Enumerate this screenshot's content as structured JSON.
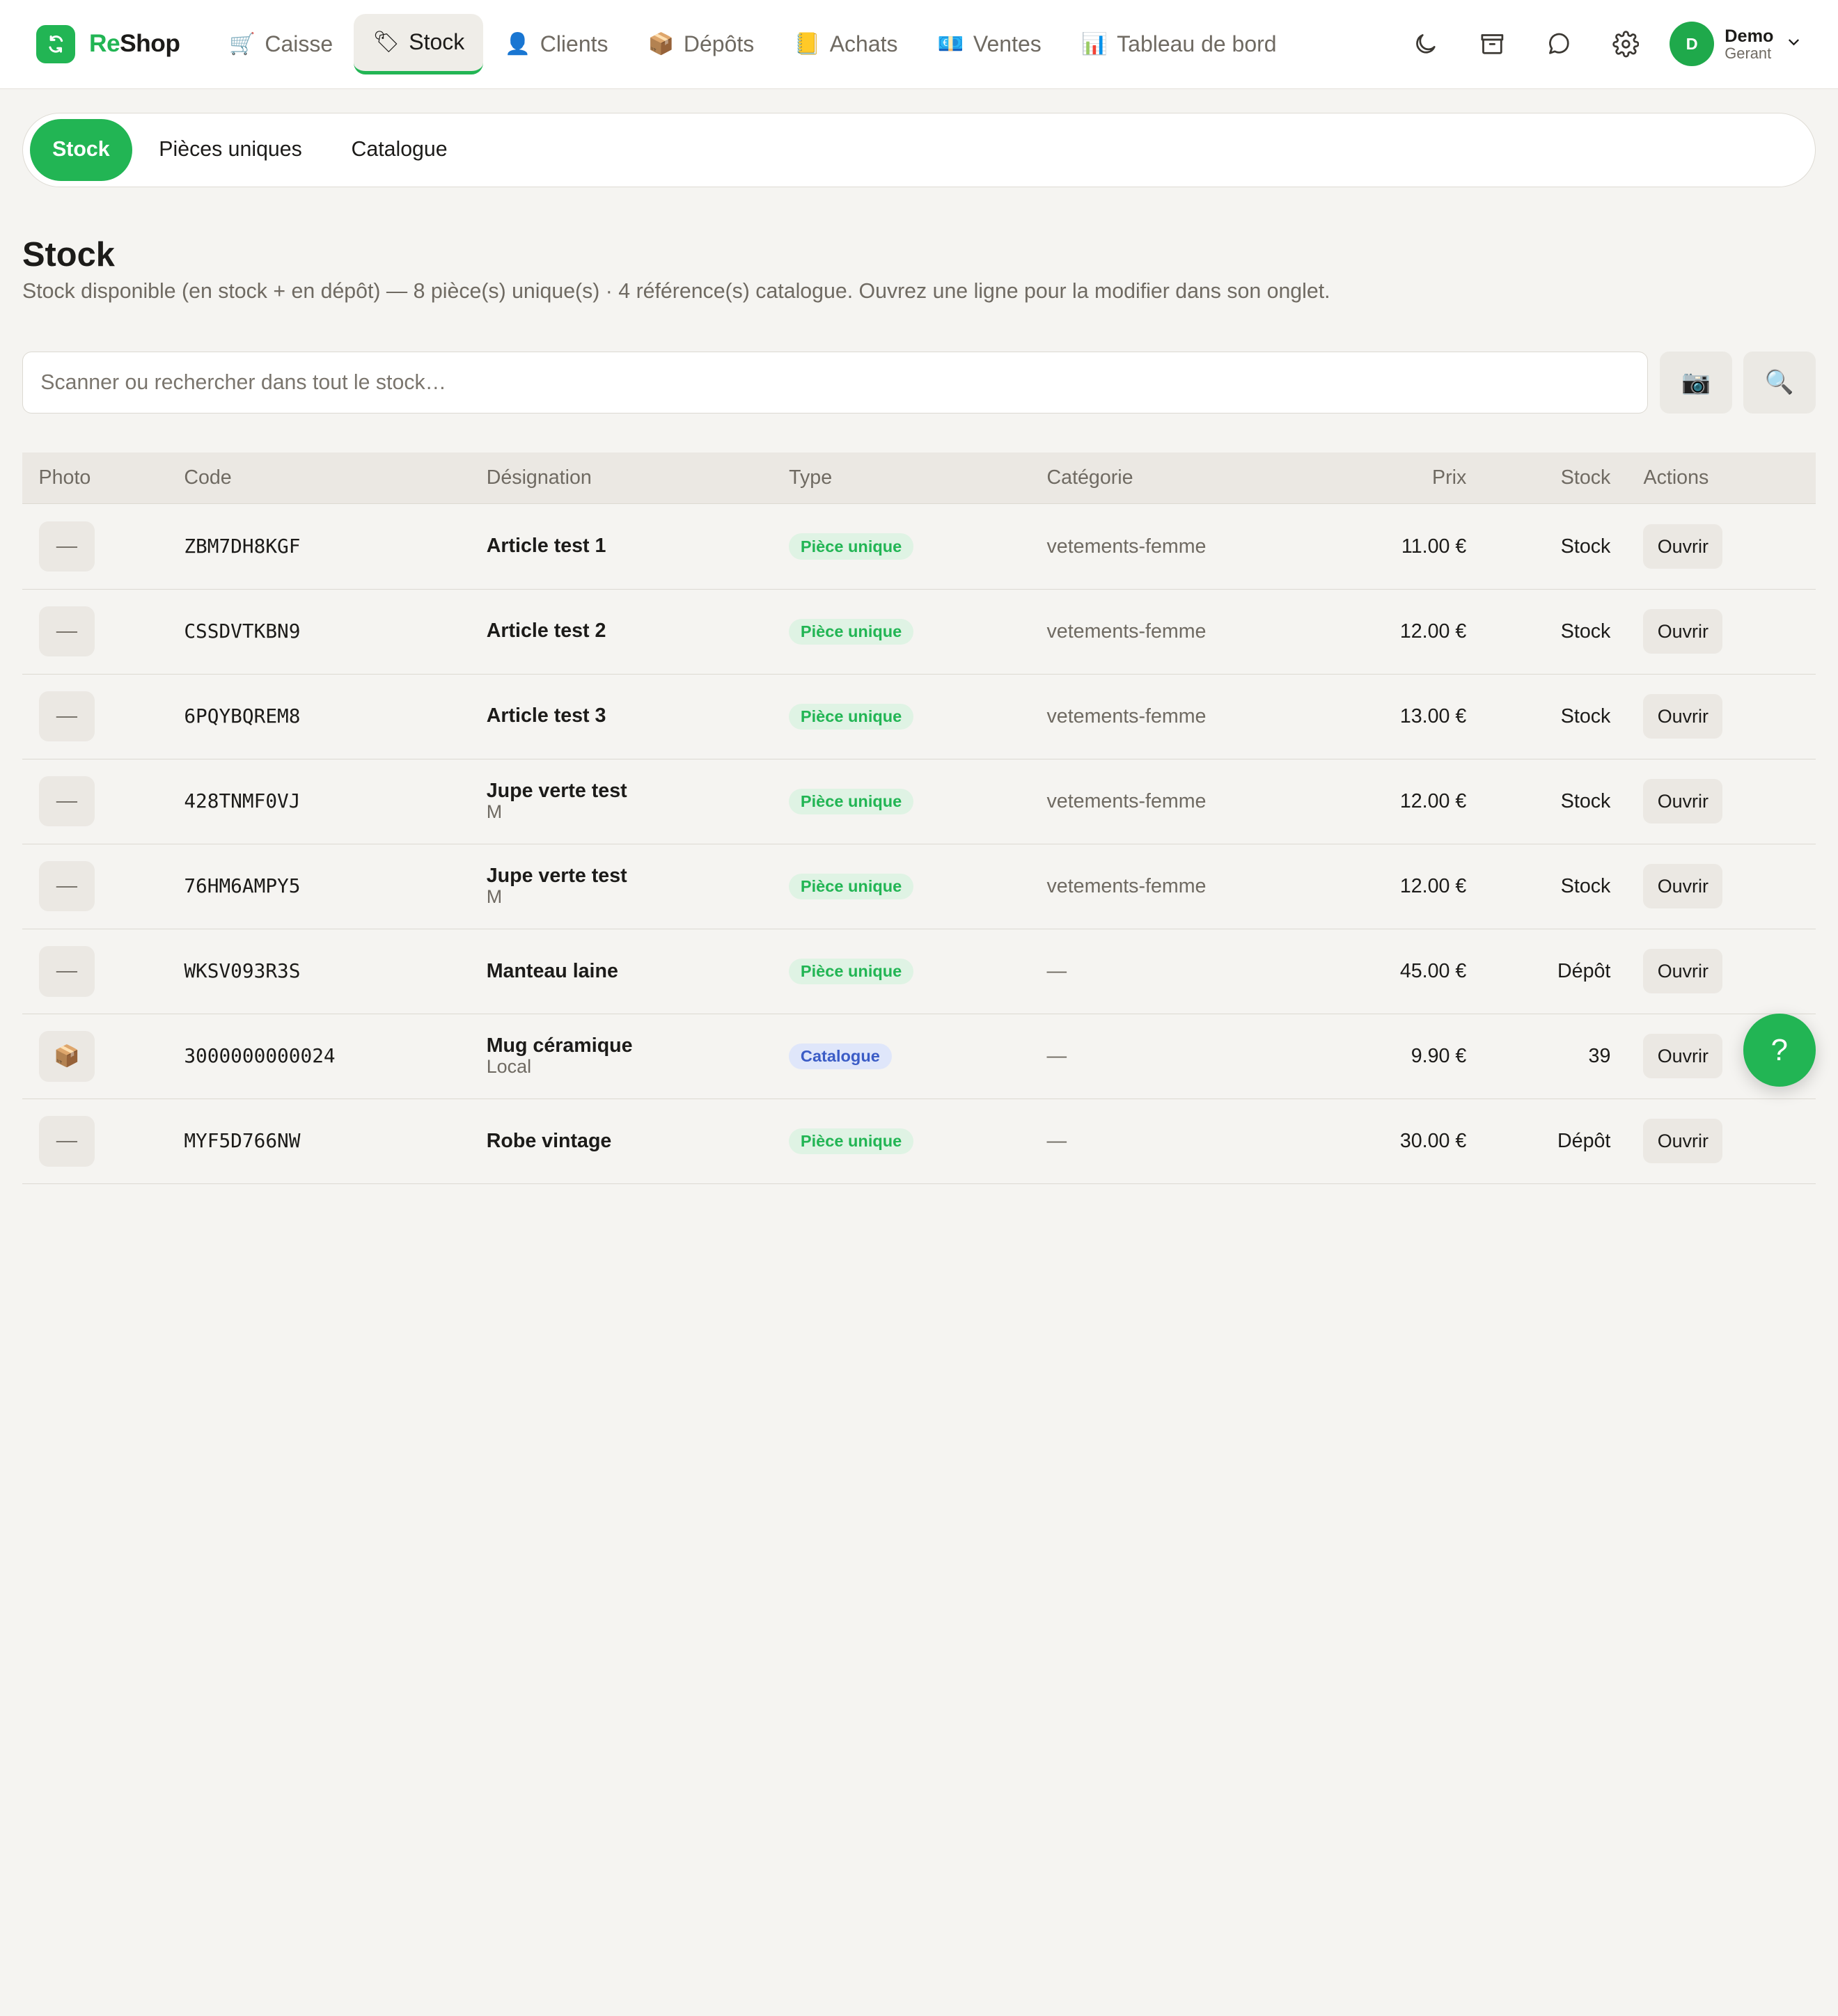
{
  "app": {
    "brand_prefix": "Re",
    "brand_suffix": "Shop",
    "logo_icon": "reshop-logo"
  },
  "nav": [
    {
      "icon": "🛒",
      "label": "Caisse"
    },
    {
      "icon": "🏷",
      "label": "Stock"
    },
    {
      "icon": "👤",
      "label": "Clients"
    },
    {
      "icon": "📦",
      "label": "Dépôts"
    },
    {
      "icon": "📒",
      "label": "Achats"
    },
    {
      "icon": "💶",
      "label": "Ventes"
    },
    {
      "icon": "📊",
      "label": "Tableau de bord"
    }
  ],
  "user": {
    "initial": "D",
    "name": "Demo",
    "role": "Gerant"
  },
  "subtabs": [
    "Stock",
    "Pièces uniques",
    "Catalogue"
  ],
  "page": {
    "title": "Stock",
    "subtitle": "Stock disponible (en stock + en dépôt) — 8 pièce(s) unique(s) · 4 référence(s) catalogue. Ouvrez une ligne pour la modifier dans son onglet."
  },
  "search": {
    "placeholder": "Scanner ou rechercher dans tout le stock…",
    "value": "",
    "camera_icon": "📷",
    "search_icon": "🔍"
  },
  "table": {
    "headers": {
      "photo": "Photo",
      "code": "Code",
      "designation": "Désignation",
      "type": "Type",
      "category": "Catégorie",
      "price": "Prix",
      "stock": "Stock",
      "actions": "Actions"
    },
    "rows": [
      {
        "photo": "—",
        "code": "ZBM7DH8KGF",
        "name": "Article test 1",
        "sub": "",
        "type": "Pièce unique",
        "type_kind": "unique",
        "category": "vetements-femme",
        "price": "11.00 €",
        "stock": "Stock",
        "action": "Ouvrir"
      },
      {
        "photo": "—",
        "code": "CSSDVTKBN9",
        "name": "Article test 2",
        "sub": "",
        "type": "Pièce unique",
        "type_kind": "unique",
        "category": "vetements-femme",
        "price": "12.00 €",
        "stock": "Stock",
        "action": "Ouvrir"
      },
      {
        "photo": "—",
        "code": "6PQYBQREM8",
        "name": "Article test 3",
        "sub": "",
        "type": "Pièce unique",
        "type_kind": "unique",
        "category": "vetements-femme",
        "price": "13.00 €",
        "stock": "Stock",
        "action": "Ouvrir"
      },
      {
        "photo": "—",
        "code": "428TNMF0VJ",
        "name": "Jupe verte test",
        "sub": "M",
        "type": "Pièce unique",
        "type_kind": "unique",
        "category": "vetements-femme",
        "price": "12.00 €",
        "stock": "Stock",
        "action": "Ouvrir"
      },
      {
        "photo": "—",
        "code": "76HM6AMPY5",
        "name": "Jupe verte test",
        "sub": "M",
        "type": "Pièce unique",
        "type_kind": "unique",
        "category": "vetements-femme",
        "price": "12.00 €",
        "stock": "Stock",
        "action": "Ouvrir"
      },
      {
        "photo": "—",
        "code": "WKSV093R3S",
        "name": "Manteau laine",
        "sub": "",
        "type": "Pièce unique",
        "type_kind": "unique",
        "category": "—",
        "price": "45.00 €",
        "stock": "Dépôt",
        "action": "Ouvrir"
      },
      {
        "photo": "📦",
        "code": "3000000000024",
        "name": "Mug céramique",
        "sub": "Local",
        "type": "Catalogue",
        "type_kind": "catalogue",
        "category": "—",
        "price": "9.90 €",
        "stock": "39",
        "action": "Ouvrir"
      },
      {
        "photo": "—",
        "code": "MYF5D766NW",
        "name": "Robe vintage",
        "sub": "",
        "type": "Pièce unique",
        "type_kind": "unique",
        "category": "—",
        "price": "30.00 €",
        "stock": "Dépôt",
        "action": "Ouvrir"
      }
    ]
  },
  "help": {
    "label": "?"
  },
  "colors": {
    "accent": "#22b554",
    "background": "#f5f4f1",
    "catalogue_badge": "#3b5cc6"
  }
}
